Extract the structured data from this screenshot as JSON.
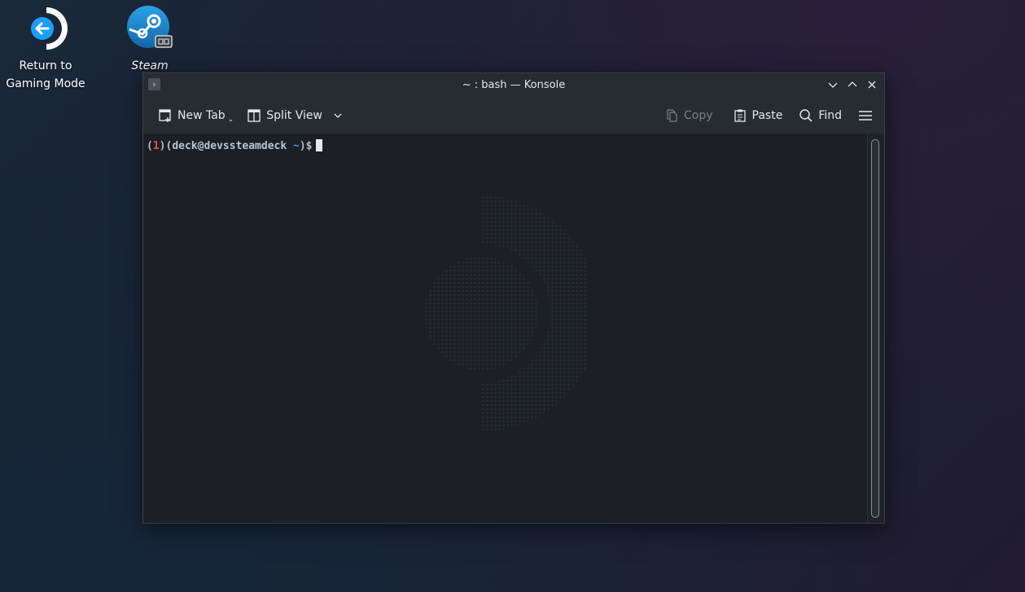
{
  "desktop": {
    "icons": [
      {
        "label": "Return to\nGaming Mode",
        "icon": "return-arrow-icon"
      },
      {
        "label": "Steam",
        "icon": "steam-icon"
      }
    ]
  },
  "window": {
    "title": "~ : bash — Konsole",
    "toolbar": {
      "new_tab_label": "New Tab",
      "split_view_label": "Split View",
      "copy_label": "Copy",
      "paste_label": "Paste",
      "find_label": "Find"
    },
    "terminal": {
      "prompt_open": "(",
      "prompt_count": "1",
      "prompt_mid": ")(",
      "prompt_user": "deck@devssteamdeck",
      "prompt_path": "~",
      "prompt_close": ")$"
    }
  },
  "colors": {
    "accent_blue": "#1a9fff",
    "prompt_count": "#e0523f",
    "prompt_path": "#4e8fd4"
  }
}
